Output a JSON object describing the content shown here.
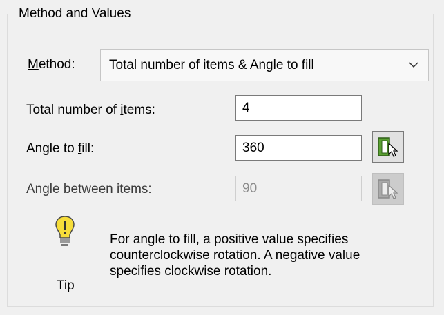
{
  "group": {
    "title": "Method and Values"
  },
  "method": {
    "label_prefix": "",
    "label_mnemonic": "M",
    "label_rest": "ethod:",
    "selected": "Total number of items & Angle to fill"
  },
  "fields": {
    "total_items": {
      "label_prefix": "Total number of ",
      "label_mnemonic": "i",
      "label_rest": "tems:",
      "value": "4"
    },
    "angle_to_fill": {
      "label_prefix": "Angle to ",
      "label_mnemonic": "f",
      "label_rest": "ill:",
      "value": "360"
    },
    "angle_between": {
      "label_prefix": "Angle ",
      "label_mnemonic": "b",
      "label_rest": "etween items:",
      "value": "90"
    }
  },
  "tip": {
    "label": "Tip",
    "lines": [
      "For angle to fill, a positive value specifies",
      "counterclockwise rotation. A negative value",
      "specifies clockwise rotation."
    ]
  },
  "icons": {
    "combo_arrow": "chevron-down-icon",
    "pick_angle": "pick-angle-icon",
    "tip": "lightbulb-icon"
  },
  "colors": {
    "pick_icon_green": "#4a8a2a",
    "bulb_yellow": "#f6dd3a"
  }
}
